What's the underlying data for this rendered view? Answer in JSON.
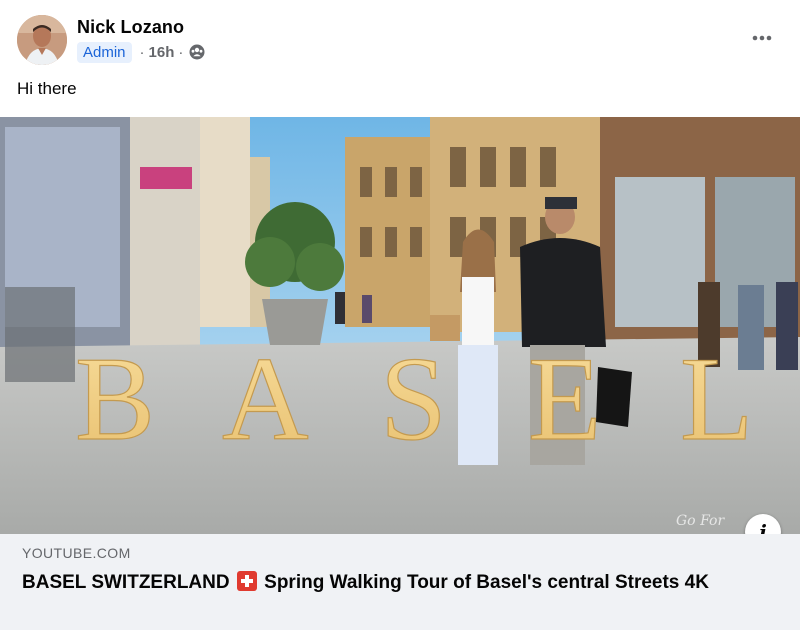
{
  "post": {
    "author": "Nick Lozano",
    "badge": "Admin",
    "time": "16h",
    "separator": "·",
    "text": "Hi there",
    "audience_icon": "group-icon",
    "more_icon": "more-horizontal-icon"
  },
  "video": {
    "overlay_text": "BASEL",
    "watermark": "Go For"
  },
  "link": {
    "domain": "YOUTUBE.COM",
    "title_part1": "BASEL SWITZERLAND",
    "flag_icon": "swiss-flag-icon",
    "title_part2": "Spring Walking Tour of Basel's central Streets 4K",
    "info_label": "i"
  },
  "colors": {
    "badge_bg": "#e7f0fd",
    "badge_text": "#1b64d8",
    "preview_bg": "#f0f2f5",
    "overlay_text": "#f2d187"
  }
}
